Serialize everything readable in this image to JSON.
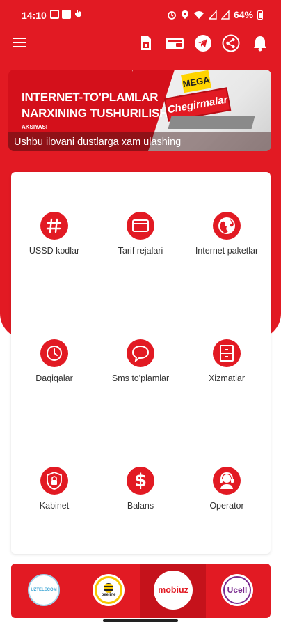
{
  "status_bar": {
    "time": "14:10",
    "battery": "64%"
  },
  "app_bar": {
    "icons": [
      "menu-icon",
      "sim-card-icon",
      "wallet-icon",
      "telegram-icon",
      "share-icon",
      "bell-icon"
    ]
  },
  "banner": {
    "line1": "INTERNET-TO'PLAMLAR",
    "line2": "NARXINING TUSHURILISHI",
    "line3": "AKSIYASI",
    "mega": "MEGA",
    "chegirmalar": "Chegirmalar",
    "caption": "Ushbu ilovani dustlarga xam ulashing"
  },
  "services": [
    {
      "label": "USSD kodlar",
      "icon": "hash-icon"
    },
    {
      "label": "Tarif rejalari",
      "icon": "card-icon"
    },
    {
      "label": "Internet paketlar",
      "icon": "globe-icon"
    },
    {
      "label": "Daqiqalar",
      "icon": "clock-icon"
    },
    {
      "label": "Sms to'plamlar",
      "icon": "chat-icon"
    },
    {
      "label": "Xizmatlar",
      "icon": "cabinet-icon"
    },
    {
      "label": "Kabinet",
      "icon": "lock-icon"
    },
    {
      "label": "Balans",
      "icon": "dollar-icon"
    },
    {
      "label": "Operator",
      "icon": "headset-icon"
    }
  ],
  "operators": [
    {
      "name": "UZTELECOM",
      "selected": false
    },
    {
      "name": "beeline",
      "selected": false
    },
    {
      "name": "mobiuz",
      "selected": true
    },
    {
      "name": "Ucell",
      "selected": false
    }
  ],
  "colors": {
    "primary": "#e21a23",
    "text": "#333333"
  }
}
